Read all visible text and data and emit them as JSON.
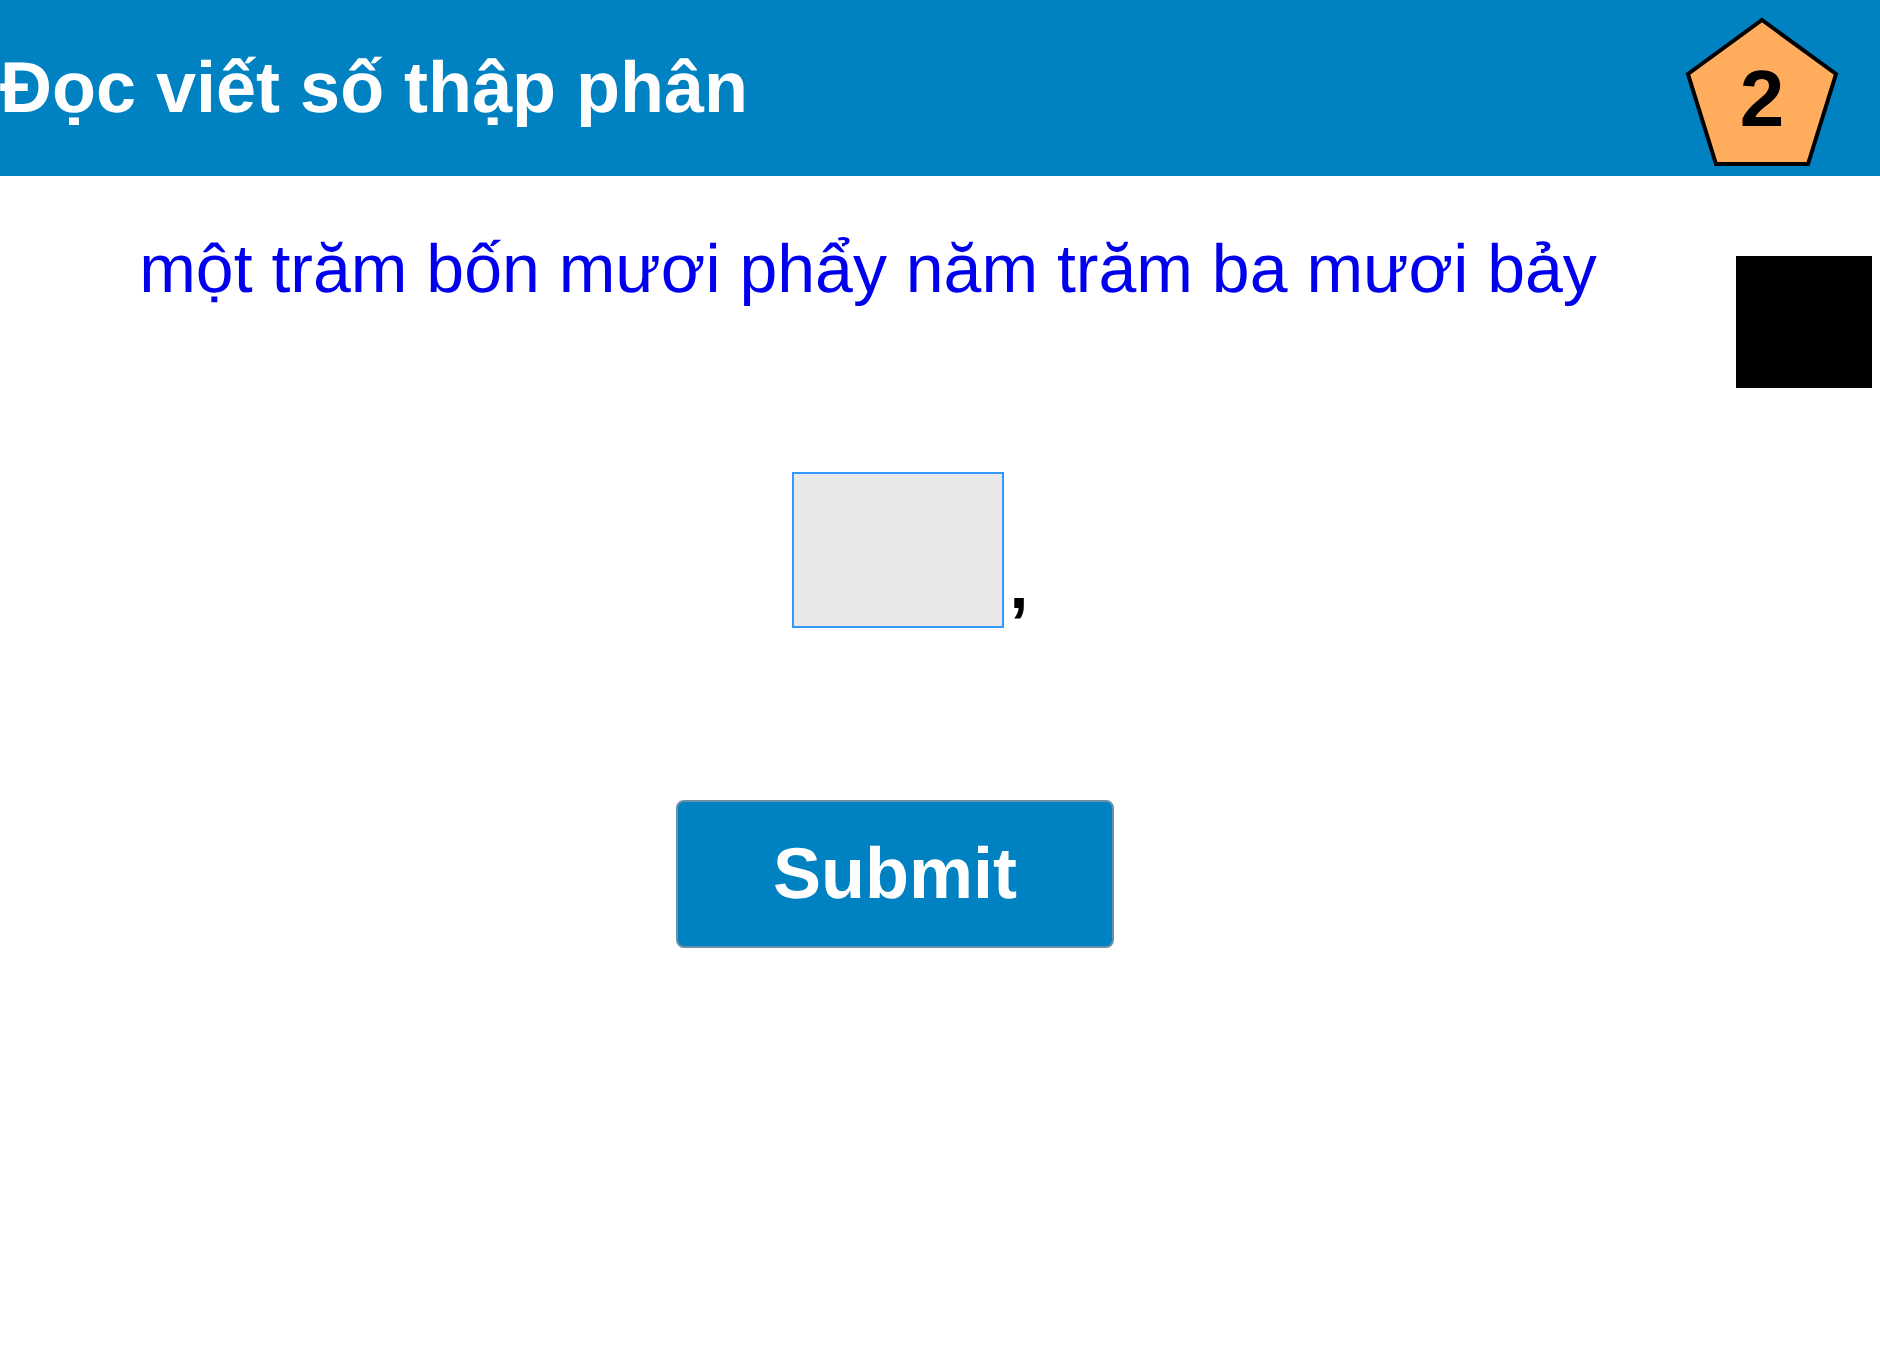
{
  "header": {
    "title": "Đọc viết số thập phân",
    "badge": "2"
  },
  "question": "một trăm bốn mươi phẩy năm trăm ba mươi bảy",
  "answer": {
    "separator": ","
  },
  "submit": "Submit"
}
